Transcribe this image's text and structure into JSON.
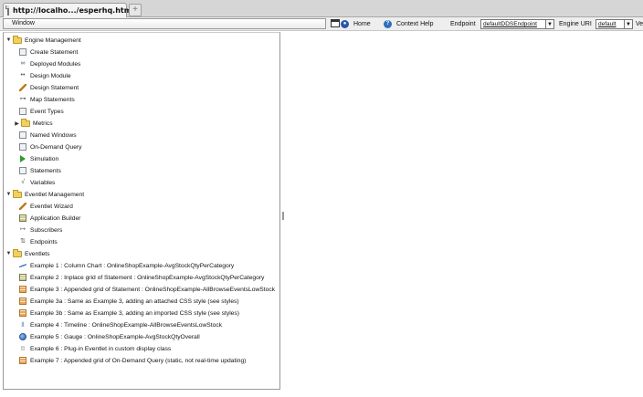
{
  "browser": {
    "tab_title": "http://localho.../esperhq.html",
    "new_tab_label": "+"
  },
  "toolbar": {
    "window_label": "Window",
    "home_label": "Home",
    "context_help_label": "Context Help",
    "endpoint_label": "Endpoint",
    "endpoint_value": "defaultDDSEndpoint",
    "engine_uri_label": "Engine URI",
    "engine_uri_value": "default",
    "trailing_label": "Ve"
  },
  "tree": {
    "engine_management": {
      "label": "Engine Management",
      "items": [
        {
          "label": "Create Statement",
          "icon": "document-icon"
        },
        {
          "label": "Deployed Modules",
          "icon": "modules-icon"
        },
        {
          "label": "Design Module",
          "icon": "dots-icon"
        },
        {
          "label": "Design Statement",
          "icon": "pencil-icon"
        },
        {
          "label": "Map Statements",
          "icon": "map-icon"
        },
        {
          "label": "Event Types",
          "icon": "document-icon"
        },
        {
          "label": "Metrics",
          "icon": "folder-icon"
        },
        {
          "label": "Named Windows",
          "icon": "window-icon"
        },
        {
          "label": "On-Demand Query",
          "icon": "query-icon"
        },
        {
          "label": "Simulation",
          "icon": "play-icon"
        },
        {
          "label": "Statements",
          "icon": "list-icon"
        },
        {
          "label": "Variables",
          "icon": "variable-icon"
        }
      ]
    },
    "eventlet_management": {
      "label": "Eventlet Management",
      "items": [
        {
          "label": "Eventlet Wizard",
          "icon": "wand-icon"
        },
        {
          "label": "Application Builder",
          "icon": "builder-icon"
        },
        {
          "label": "Subscribers",
          "icon": "subscriber-icon"
        },
        {
          "label": "Endpoints",
          "icon": "endpoint-icon"
        }
      ]
    },
    "eventlets": {
      "label": "Eventlets",
      "items": [
        {
          "label": "Example 1 : Column Chart : OnlineShopExample-AvgStockQtyPerCategory",
          "icon": "line-chart-icon"
        },
        {
          "label": "Example 2 : Inplace grid of Statement : OnlineShopExample-AvgStockQtyPerCategory",
          "icon": "grid-icon"
        },
        {
          "label": "Example 3 : Appended grid of Statement : OnlineShopExample-AllBrowseEventsLowStock",
          "icon": "orange-grid-icon"
        },
        {
          "label": "Example 3a : Same as Example 3, adding an attached CSS style (see styles)",
          "icon": "orange-grid-icon"
        },
        {
          "label": "Example 3b : Same as Example 3, adding an imported CSS style (see styles)",
          "icon": "orange-grid-icon"
        },
        {
          "label": "Example 4 : Timeline : OnlineShopExample-AllBrowseEventsLowStock",
          "icon": "timeline-icon"
        },
        {
          "label": "Example 5 : Gauge : OnlineShopExample-AvgStockQtyOverall",
          "icon": "gauge-icon"
        },
        {
          "label": "Example 6 : Plug-in Eventlet in custom display class",
          "icon": "plugin-icon"
        },
        {
          "label": "Example 7 : Appended grid of On-Demand Query (static, not real-time updating)",
          "icon": "orange-grid-icon"
        }
      ]
    }
  }
}
